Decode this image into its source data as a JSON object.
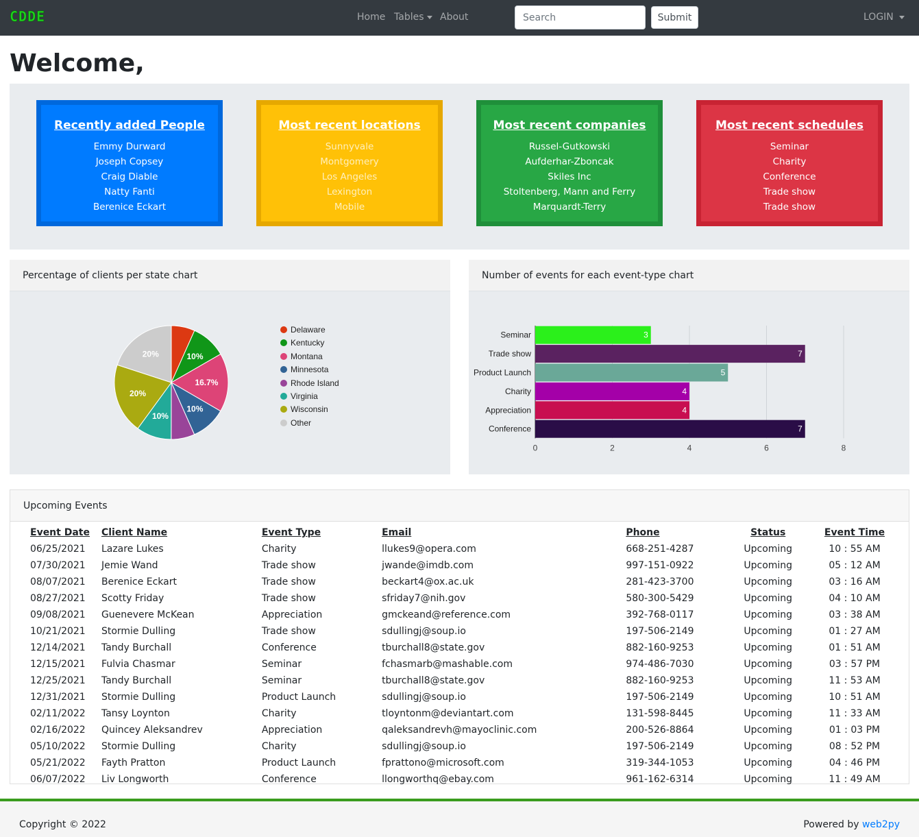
{
  "nav": {
    "brand": "CDDE",
    "home": "Home",
    "tables": "Tables",
    "about": "About",
    "search_placeholder": "Search",
    "submit": "Submit",
    "login": "LOGIN"
  },
  "welcome": "Welcome,",
  "cards": [
    {
      "title": "Recently added People",
      "items": [
        "Emmy Durward",
        "Joseph Copsey",
        "Craig Diable",
        "Natty Fanti",
        "Berenice Eckart"
      ]
    },
    {
      "title": "Most recent locations",
      "items": [
        "Sunnyvale",
        "Montgomery",
        "Los Angeles",
        "Lexington",
        "Mobile"
      ]
    },
    {
      "title": "Most recent companies",
      "items": [
        "Russel-Gutkowski",
        "Aufderhar-Zboncak",
        "Skiles Inc",
        "Stoltenberg, Mann and Ferry",
        "Marquardt-Terry"
      ]
    },
    {
      "title": "Most recent schedules",
      "items": [
        "Seminar",
        "Charity",
        "Conference",
        "Trade show",
        "Trade show"
      ]
    }
  ],
  "pie_panel": {
    "title": "Percentage of clients per state chart"
  },
  "bar_panel": {
    "title": "Number of events for each event-type chart"
  },
  "chart_data": [
    {
      "type": "pie",
      "title": "",
      "labels": [
        "Delaware",
        "Kentucky",
        "Montana",
        "Minnesota",
        "Rhode Island",
        "Virginia",
        "Wisconsin",
        "Other"
      ],
      "values": [
        6.7,
        10,
        16.7,
        10,
        6.7,
        10,
        20,
        20
      ],
      "value_labels": [
        "",
        "10%",
        "16.7%",
        "10%",
        "",
        "10%",
        "20%",
        "20%"
      ],
      "colors": [
        "#dc3912",
        "#109618",
        "#dd4477",
        "#316395",
        "#994499",
        "#22aa99",
        "#aaaa11",
        "#cccccc"
      ],
      "legend": "right"
    },
    {
      "type": "bar",
      "orientation": "horizontal",
      "title": "",
      "categories": [
        "Seminar",
        "Trade show",
        "Product Launch",
        "Charity",
        "Appreciation",
        "Conference"
      ],
      "values": [
        3,
        7,
        5,
        4,
        4,
        7
      ],
      "colors": [
        "#2bf01b",
        "#5a2260",
        "#6aa898",
        "#a400a8",
        "#c80e50",
        "#2a0d47"
      ],
      "xlim": [
        0,
        8
      ],
      "xticks": [
        0,
        2,
        4,
        6,
        8
      ],
      "grid": true
    }
  ],
  "events": {
    "title": "Upcoming Events",
    "columns": [
      "Event Date",
      "Client Name",
      "Event Type",
      "Email",
      "Phone",
      "Status",
      "Event Time"
    ],
    "rows": [
      [
        "06/25/2021",
        "Lazare Lukes",
        "Charity",
        "llukes9@opera.com",
        "668-251-4287",
        "Upcoming",
        "10 : 55 AM"
      ],
      [
        "07/30/2021",
        "Jemie Wand",
        "Trade show",
        "jwande@imdb.com",
        "997-151-0922",
        "Upcoming",
        "05 : 12 AM"
      ],
      [
        "08/07/2021",
        "Berenice Eckart",
        "Trade show",
        "beckart4@ox.ac.uk",
        "281-423-3700",
        "Upcoming",
        "03 : 16 AM"
      ],
      [
        "08/27/2021",
        "Scotty Friday",
        "Trade show",
        "sfriday7@nih.gov",
        "580-300-5429",
        "Upcoming",
        "04 : 10 AM"
      ],
      [
        "09/08/2021",
        "Guenevere McKean",
        "Appreciation",
        "gmckeand@reference.com",
        "392-768-0117",
        "Upcoming",
        "03 : 38 AM"
      ],
      [
        "10/21/2021",
        "Stormie Dulling",
        "Trade show",
        "sdullingj@soup.io",
        "197-506-2149",
        "Upcoming",
        "01 : 27 AM"
      ],
      [
        "12/14/2021",
        "Tandy Burchall",
        "Conference",
        "tburchall8@state.gov",
        "882-160-9253",
        "Upcoming",
        "01 : 51 AM"
      ],
      [
        "12/15/2021",
        "Fulvia Chasmar",
        "Seminar",
        "fchasmarb@mashable.com",
        "974-486-7030",
        "Upcoming",
        "03 : 57 PM"
      ],
      [
        "12/25/2021",
        "Tandy Burchall",
        "Seminar",
        "tburchall8@state.gov",
        "882-160-9253",
        "Upcoming",
        "11 : 53 AM"
      ],
      [
        "12/31/2021",
        "Stormie Dulling",
        "Product Launch",
        "sdullingj@soup.io",
        "197-506-2149",
        "Upcoming",
        "10 : 51 AM"
      ],
      [
        "02/11/2022",
        "Tansy Loynton",
        "Charity",
        "tloyntonm@deviantart.com",
        "131-598-8445",
        "Upcoming",
        "11 : 33 AM"
      ],
      [
        "02/16/2022",
        "Quincey Aleksandrev",
        "Appreciation",
        "qaleksandrevh@mayoclinic.com",
        "200-526-8864",
        "Upcoming",
        "01 : 03 PM"
      ],
      [
        "05/10/2022",
        "Stormie Dulling",
        "Charity",
        "sdullingj@soup.io",
        "197-506-2149",
        "Upcoming",
        "08 : 52 PM"
      ],
      [
        "05/21/2022",
        "Fayth Pratton",
        "Product Launch",
        "fprattono@microsoft.com",
        "319-344-1053",
        "Upcoming",
        "04 : 46 PM"
      ],
      [
        "06/07/2022",
        "Liv Longworth",
        "Conference",
        "llongworthq@ebay.com",
        "961-162-6314",
        "Upcoming",
        "11 : 49 AM"
      ]
    ]
  },
  "footer": {
    "copyright": "Copyright © 2022",
    "powered_by": "Powered by",
    "link": "web2py"
  }
}
